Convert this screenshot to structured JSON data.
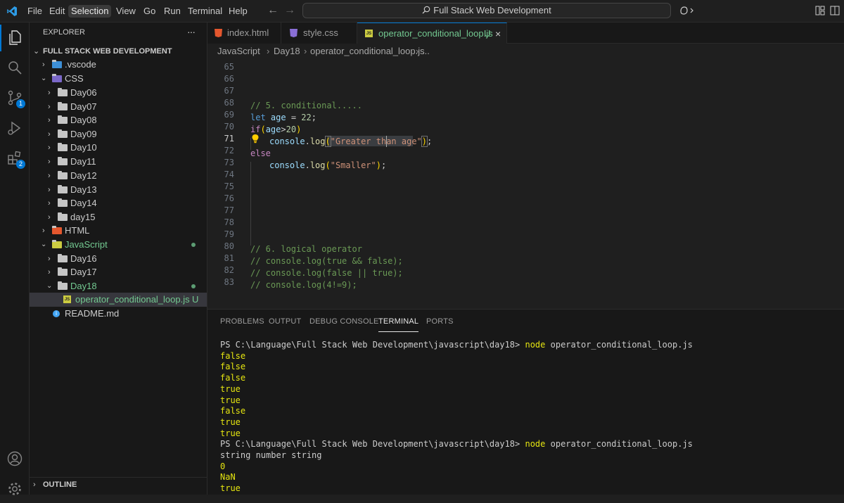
{
  "menu": [
    "File",
    "Edit",
    "Selection",
    "View",
    "Go",
    "Run",
    "Terminal",
    "Help"
  ],
  "active_menu": "Selection",
  "command_center": "Full Stack Web Development",
  "activity_badges": {
    "source_control": "1",
    "extensions": "2"
  },
  "explorer": {
    "title": "EXPLORER",
    "more": "···",
    "root": "FULL STACK WEB DEVELOPMENT",
    "items": [
      {
        "label": ".vscode"
      },
      {
        "label": "CSS"
      },
      {
        "label": "Day06"
      },
      {
        "label": "Day07"
      },
      {
        "label": "Day08"
      },
      {
        "label": "Day09"
      },
      {
        "label": "Day10"
      },
      {
        "label": "Day11"
      },
      {
        "label": "Day12"
      },
      {
        "label": "Day13"
      },
      {
        "label": "Day14"
      },
      {
        "label": "day15"
      },
      {
        "label": "HTML"
      },
      {
        "label": "JavaScript"
      },
      {
        "label": "Day16"
      },
      {
        "label": "Day17"
      },
      {
        "label": "Day18"
      },
      {
        "label": "operator_conditional_loop.js",
        "status": "U"
      },
      {
        "label": "README.md"
      }
    ],
    "outline": "OUTLINE"
  },
  "tabs": [
    {
      "label": "index.html"
    },
    {
      "label": "style.css"
    },
    {
      "label": "operator_conditional_loop.js",
      "status": "U"
    }
  ],
  "breadcrumb": [
    "JavaScript",
    "Day18",
    "operator_conditional_loop.js",
    "..."
  ],
  "line_numbers": [
    "65",
    "66",
    "67",
    "68",
    "69",
    "70",
    "71",
    "72",
    "73",
    "74",
    "75",
    "76",
    "77",
    "78",
    "79",
    "80",
    "81",
    "82",
    "83"
  ],
  "code": {
    "l68": "// 5. conditional.....",
    "l69": {
      "kw": "let",
      "var": "age",
      "op": " = ",
      "num": "22",
      "end": ";"
    },
    "l70": {
      "kw": "if",
      "open": "(",
      "var": "age",
      "op": ">",
      "num": "20",
      "close": ")"
    },
    "l71": {
      "obj": "console",
      "dot": ".",
      "fn": "log",
      "open": "(",
      "str": "\"Greater than age\"",
      "close": ")",
      "end": ";"
    },
    "l72": "else",
    "l73": {
      "obj": "console",
      "dot": ".",
      "fn": "log",
      "open": "(",
      "str": "\"Smaller\"",
      "close": ")",
      "end": ";"
    },
    "l80": "// 6. logical operator",
    "l81": "// console.log(true && false);",
    "l82": "// console.log(false || true);",
    "l83": "// console.log(4!=9);"
  },
  "panel_tabs": [
    "PROBLEMS",
    "OUTPUT",
    "DEBUG CONSOLE",
    "TERMINAL",
    "PORTS"
  ],
  "active_panel_tab": "TERMINAL",
  "terminal": {
    "prompt": "PS C:\\Language\\Full Stack Web Development\\javascript\\day18> ",
    "cmd_name": "node",
    "cmd_arg": " operator_conditional_loop.js",
    "out1": [
      "false",
      "false",
      "false",
      "true",
      "true",
      "false",
      "true",
      "true"
    ],
    "out2_text": "string number string",
    "out2": [
      "0",
      "NaN",
      "true"
    ]
  },
  "colors": {
    "accent": "#0078d4",
    "modified": "#73c991",
    "js_icon": "#cbcb41"
  }
}
